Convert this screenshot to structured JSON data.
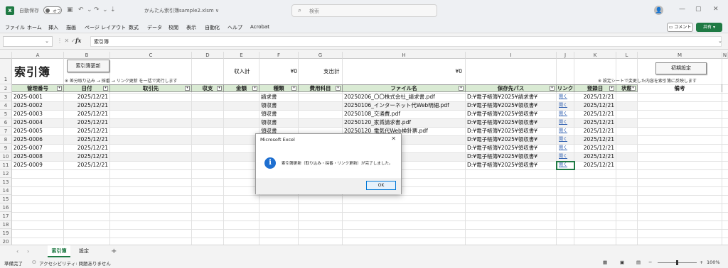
{
  "window": {
    "autosave_label": "自動保存",
    "autosave_state": "オフ",
    "doc_title": "かんたん索引簿sample2.xlsm ∨",
    "search_placeholder": "検索",
    "user_initial": "👤"
  },
  "menu": {
    "items": [
      "ファイル",
      "ホーム",
      "挿入",
      "描画",
      "ページ レイアウト",
      "数式",
      "データ",
      "校閲",
      "表示",
      "自動化",
      "ヘルプ",
      "Acrobat"
    ],
    "comment_label": "コメント",
    "share_label": "共有"
  },
  "formula_bar": {
    "name_box": "",
    "fx": "fx",
    "content": "索引簿"
  },
  "columns": [
    "A",
    "B",
    "C",
    "D",
    "E",
    "F",
    "G",
    "H",
    "I",
    "J",
    "K",
    "L",
    "M",
    "N"
  ],
  "rows": [
    "1",
    "2",
    "3",
    "4",
    "5",
    "6",
    "7",
    "8",
    "9",
    "10",
    "11",
    "12",
    "13",
    "14",
    "15",
    "16",
    "17",
    "18",
    "19",
    "20"
  ],
  "sheet": {
    "title": "索引簿",
    "update_button": "索引簿更新",
    "update_note": "※ 差分取り込み → 採番 → リンク更新 を一括で実行します",
    "income_label": "収入計",
    "income_value": "¥0",
    "expense_label": "支出計",
    "expense_value": "¥0",
    "init_button": "初期設定",
    "init_note": "※ 設定シートで変更した内容を索引簿に反映します",
    "headers": [
      "管理番号",
      "日付",
      "取引先",
      "収支",
      "金額",
      "種類",
      "費用科目",
      "ファイル名",
      "保存先パス",
      "リンク",
      "登録日",
      "状態",
      "備考"
    ],
    "data_rows": [
      {
        "id": "2025-0001",
        "date": "2025/12/21",
        "type": "請求書",
        "file": "20250206_〇〇株式会社_請求書.pdf",
        "path": "D:¥電子帳簿¥2025¥請求書¥",
        "link": "開く",
        "reg": "2025/12/21"
      },
      {
        "id": "2025-0002",
        "date": "2025/12/21",
        "type": "領収書",
        "file": "20250106_インターネット代Web明細.pdf",
        "path": "D:¥電子帳簿¥2025¥領収書¥",
        "link": "開く",
        "reg": "2025/12/21"
      },
      {
        "id": "2025-0003",
        "date": "2025/12/21",
        "type": "領収書",
        "file": "20250108_交通費.pdf",
        "path": "D:¥電子帳簿¥2025¥領収書¥",
        "link": "開く",
        "reg": "2025/12/21"
      },
      {
        "id": "2025-0004",
        "date": "2025/12/21",
        "type": "領収書",
        "file": "20250120_家賃請求書.pdf",
        "path": "D:¥電子帳簿¥2025¥領収書¥",
        "link": "開く",
        "reg": "2025/12/21"
      },
      {
        "id": "2025-0005",
        "date": "2025/12/21",
        "type": "領収書",
        "file": "20250120_電気代Web検針票.pdf",
        "path": "D:¥電子帳簿¥2025¥領収書¥",
        "link": "開く",
        "reg": "2025/12/21"
      },
      {
        "id": "2025-0006",
        "date": "2025/12/21",
        "type": "",
        "file": "ット代Web明細.pdf",
        "path": "D:¥電子帳簿¥2025¥領収書¥",
        "link": "開く",
        "reg": "2025/12/21"
      },
      {
        "id": "2025-0007",
        "date": "2025/12/21",
        "type": "",
        "file": "pdf",
        "path": "D:¥電子帳簿¥2025¥領収書¥",
        "link": "開く",
        "reg": "2025/12/21"
      },
      {
        "id": "2025-0008",
        "date": "2025/12/21",
        "type": "",
        "file": "pdf",
        "path": "D:¥電子帳簿¥2025¥領収書¥",
        "link": "開く",
        "reg": "2025/12/21"
      },
      {
        "id": "2025-0009",
        "date": "2025/12/21",
        "type": "",
        "file": "eb検針票.pdf",
        "path": "D:¥電子帳簿¥2025¥領収書¥",
        "link": "開く",
        "reg": "2025/12/21"
      }
    ]
  },
  "dialog": {
    "title": "Microsoft Excel",
    "message": "索引簿更新（取り込み・採番・リンク更新）が完了しました。",
    "ok_label": "OK"
  },
  "tabs": {
    "sheets": [
      "索引簿",
      "設定"
    ],
    "active": "索引簿",
    "add": "+"
  },
  "status": {
    "ready": "準備完了",
    "accessibility": "アクセシビリティ: 問題ありません",
    "zoom": "100%"
  }
}
